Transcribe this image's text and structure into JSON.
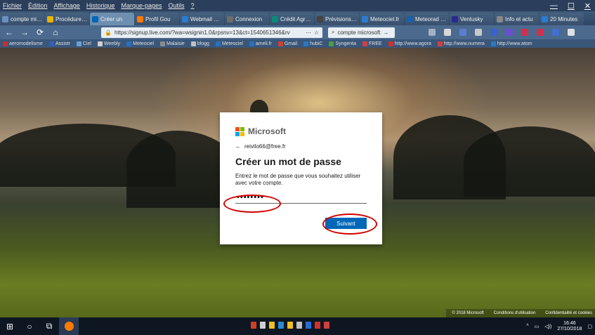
{
  "menubar": {
    "items": [
      "Fichier",
      "Édition",
      "Affichage",
      "Historique",
      "Marque-pages",
      "Outils",
      "?"
    ],
    "controls": [
      "—",
      "☐",
      "✕"
    ]
  },
  "tabs": [
    {
      "label": "compte micro",
      "color": "#6a8fbf"
    },
    {
      "label": "Procédure de",
      "color": "#e8b400"
    },
    {
      "label": "Créer un",
      "color": "#0067b8",
      "active": true
    },
    {
      "label": "Profil Gou",
      "color": "#ff7a00"
    },
    {
      "label": "Webmail Fre",
      "color": "#2a7dd1"
    },
    {
      "label": "Connexion",
      "color": "#6d6d6d"
    },
    {
      "label": "Crédit Agricol",
      "color": "#0a8a7a"
    },
    {
      "label": "Prévisions m",
      "color": "#444"
    },
    {
      "label": "Meteociel.fr",
      "color": "#2a7dd1"
    },
    {
      "label": "Meteorad RG",
      "color": "#1d5fa8"
    },
    {
      "label": "Ventusky",
      "color": "#2a2a90"
    },
    {
      "label": "Info et actu",
      "color": "#8a8a8a"
    },
    {
      "label": "20 Minutes",
      "color": "#2a7dd1"
    }
  ],
  "nav": {
    "url": "https://signup.live.com/?wa=wsignin1.0&rpsnv=13&ct=1540651346&rv",
    "search": "compte microsoft"
  },
  "bookmarks": [
    "aeromodelisme",
    "Assistr",
    "Ciel",
    "Weebly",
    "Meteociel",
    "Malaisie",
    "blogg",
    "Meteociel",
    "ameli.fr",
    "Gmail",
    "hubiC",
    "Syngenta",
    "FREE",
    "http://www.agora",
    "http://www.numera",
    "http://www.atom"
  ],
  "dialog": {
    "brand": "Microsoft",
    "back_arrow": "←",
    "email": "reivilo66@free.fr",
    "title": "Créer un mot de passe",
    "description": "Entrez le mot de passe que vous souhaitez utiliser avec votre compte.",
    "password_value": "••••••••",
    "next_label": "Suivant",
    "logo_colors": [
      "#f25022",
      "#7fba00",
      "#00a4ef",
      "#ffb900"
    ]
  },
  "footer": {
    "copyright": "© 2018 Microsoft",
    "terms": "Conditions d'utilisation",
    "privacy": "Confidentialité et cookies"
  },
  "taskbar": {
    "time": "16:46",
    "date": "27/10/2018"
  }
}
